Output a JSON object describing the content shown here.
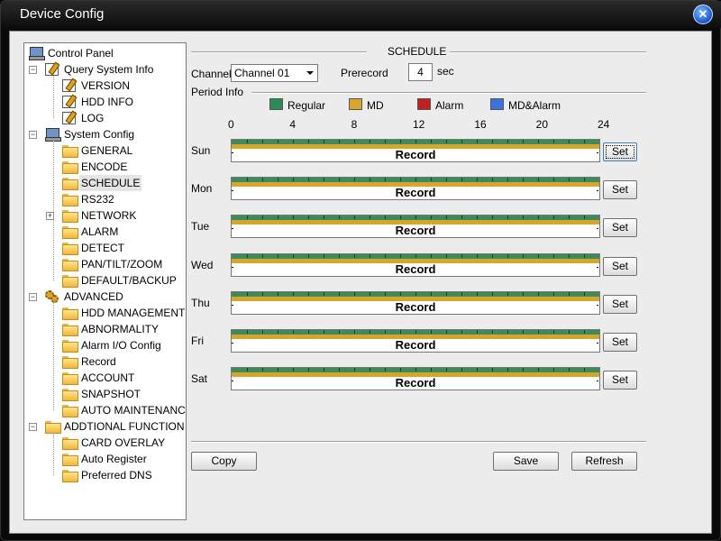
{
  "window": {
    "title": "Device Config",
    "close_icon": "close-icon"
  },
  "tree": {
    "root": "Control Panel",
    "groups": [
      {
        "label": "Query System Info",
        "expanded": true,
        "icon": "doc-edit-icon",
        "items": [
          {
            "label": "VERSION",
            "icon": "doc-edit-icon"
          },
          {
            "label": "HDD INFO",
            "icon": "doc-edit-icon"
          },
          {
            "label": "LOG",
            "icon": "doc-edit-icon"
          }
        ]
      },
      {
        "label": "System Config",
        "expanded": true,
        "icon": "system-config-icon",
        "items": [
          {
            "label": "GENERAL",
            "icon": "folder-icon"
          },
          {
            "label": "ENCODE",
            "icon": "folder-icon"
          },
          {
            "label": "SCHEDULE",
            "icon": "folder-open-icon",
            "selected": true
          },
          {
            "label": "RS232",
            "icon": "folder-icon"
          },
          {
            "label": "NETWORK",
            "icon": "folder-icon",
            "expandable": true
          },
          {
            "label": "ALARM",
            "icon": "folder-icon"
          },
          {
            "label": "DETECT",
            "icon": "folder-icon"
          },
          {
            "label": "PAN/TILT/ZOOM",
            "icon": "folder-icon"
          },
          {
            "label": "DEFAULT/BACKUP",
            "icon": "folder-icon"
          }
        ]
      },
      {
        "label": "ADVANCED",
        "expanded": true,
        "icon": "gears-icon",
        "items": [
          {
            "label": "HDD MANAGEMENT",
            "icon": "folder-icon"
          },
          {
            "label": "ABNORMALITY",
            "icon": "folder-icon"
          },
          {
            "label": "Alarm I/O Config",
            "icon": "folder-icon"
          },
          {
            "label": "Record",
            "icon": "folder-icon"
          },
          {
            "label": "ACCOUNT",
            "icon": "folder-icon"
          },
          {
            "label": "SNAPSHOT",
            "icon": "folder-icon"
          },
          {
            "label": "AUTO MAINTENANC",
            "icon": "folder-icon"
          }
        ]
      },
      {
        "label": "ADDTIONAL FUNCTION",
        "expanded": true,
        "icon": "folder-icon",
        "items": [
          {
            "label": "CARD OVERLAY",
            "icon": "folder-icon"
          },
          {
            "label": "Auto Register",
            "icon": "folder-icon"
          },
          {
            "label": "Preferred DNS",
            "icon": "folder-icon"
          }
        ]
      }
    ]
  },
  "schedule": {
    "section_title": "SCHEDULE",
    "channel_label": "Channel",
    "channel_value": "Channel 01",
    "prerecord_label": "Prerecord",
    "prerecord_value": "4",
    "prerecord_unit": "sec",
    "period_info_label": "Period Info",
    "legend": [
      {
        "label": "Regular",
        "color": "#2e8b57"
      },
      {
        "label": "MD",
        "color": "#d9a52a"
      },
      {
        "label": "Alarm",
        "color": "#c02020"
      },
      {
        "label": "MD&Alarm",
        "color": "#3a73e0"
      }
    ],
    "hour_labels": [
      "0",
      "4",
      "8",
      "12",
      "16",
      "20",
      "24"
    ],
    "timeline_colors": {
      "regular": "#3d8a5a",
      "md": "#d6a62a"
    },
    "days": [
      {
        "label": "Sun",
        "bar_text": "Record",
        "set_label": "Set",
        "focused": true
      },
      {
        "label": "Mon",
        "bar_text": "Record",
        "set_label": "Set"
      },
      {
        "label": "Tue",
        "bar_text": "Record",
        "set_label": "Set"
      },
      {
        "label": "Wed",
        "bar_text": "Record",
        "set_label": "Set"
      },
      {
        "label": "Thu",
        "bar_text": "Record",
        "set_label": "Set"
      },
      {
        "label": "Fri",
        "bar_text": "Record",
        "set_label": "Set"
      },
      {
        "label": "Sat",
        "bar_text": "Record",
        "set_label": "Set"
      }
    ],
    "buttons": {
      "copy": "Copy",
      "save": "Save",
      "refresh": "Refresh"
    }
  }
}
